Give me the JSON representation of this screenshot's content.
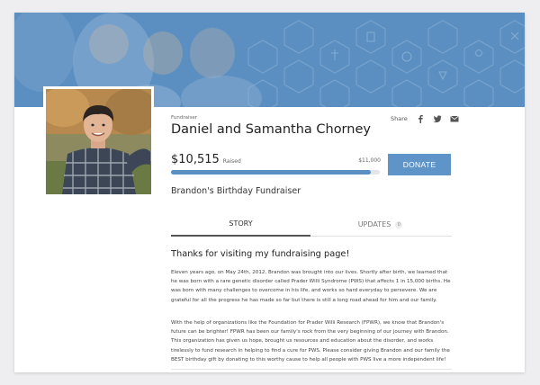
{
  "fundraiser": {
    "label": "Fundraiser",
    "title": "Daniel and Samantha Chorney",
    "subtitle": "Brandon's Birthday Fundraiser"
  },
  "share": {
    "label": "Share",
    "icons": [
      "facebook-icon",
      "twitter-icon",
      "email-icon"
    ]
  },
  "progress": {
    "raised_amount": "$10,515",
    "raised_label": "Raised",
    "goal": "$11,000",
    "fraction": 0.956
  },
  "donate_label": "DONATE",
  "tabs": [
    {
      "label": "STORY",
      "active": true
    },
    {
      "label": "UPDATES",
      "count": "0",
      "active": false
    }
  ],
  "story": {
    "heading": "Thanks for visiting my fundraising page!",
    "para1": "Eleven years ago, on May 24th, 2012, Brandon was brought into our lives. Shortly after birth, we learned that he was born with a rare genetic disorder called Prader Willi Syndrome (PWS) that affects 1 in 15,000 births. He was born with many challenges to overcome in his life, and works so hard everyday to persevere.  We are grateful for all the progress he has made so far but there is still a long road ahead for him and our family.",
    "para2": "With the help of organizations like the Foundation for Prader Willi Research (FPWR), we know that Brandon's future can be brighter!  FPWR has been our family's rock from the very beginning of our journey with Brandon. This organization has given us hope, brought us resources and education about the disorder, and works tirelessly to fund research in helping to find a cure for PWS. Please consider giving Brandon and our family the BEST birthday gift by donating to this worthy cause to help all people with PWS live a more independent life!"
  },
  "colors": {
    "accent": "#5e94c8",
    "banner": "#5b8fc1",
    "page_bg": "#eeeef0"
  }
}
